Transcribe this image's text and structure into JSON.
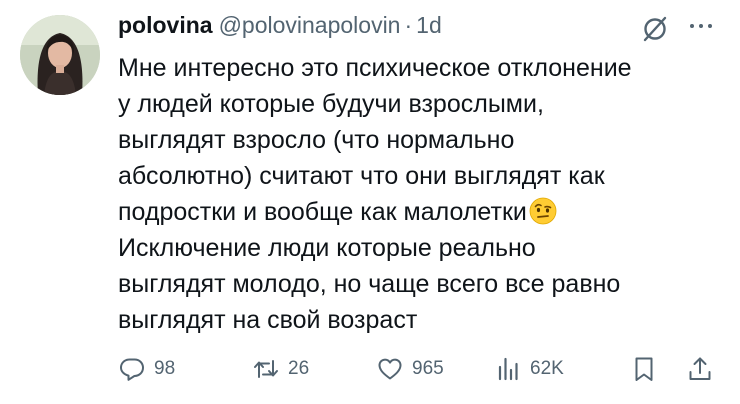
{
  "tweet": {
    "author_name": "polovina",
    "handle": "@polovinapolovin",
    "separator": "·",
    "time": "1d",
    "text_lines": [
      "Мне интересно это психическое отклонение",
      "у людей которые будучи взрослыми,",
      "выглядят взросло (что нормально",
      "абсолютно) считают что они выглядят как",
      "подростки и вообще как малолетки",
      "Исключение люди которые реально",
      "выглядят молодо, но чаще всего все равно",
      "выглядят на свой возраст"
    ],
    "emoji": "raised-eyebrow-face"
  },
  "actions": {
    "replies": "98",
    "reposts": "26",
    "likes": "965",
    "views": "62K"
  },
  "icons": {
    "reply": "speech-bubble-icon",
    "repost": "repost-arrows-icon",
    "like": "heart-icon",
    "views": "bar-chart-icon",
    "bookmark": "bookmark-icon",
    "share": "share-upload-icon",
    "grok": "slashed-circle-icon",
    "more": "ellipsis-icon"
  },
  "colors": {
    "text": "#0f1419",
    "secondary": "#536471",
    "background": "#ffffff"
  }
}
